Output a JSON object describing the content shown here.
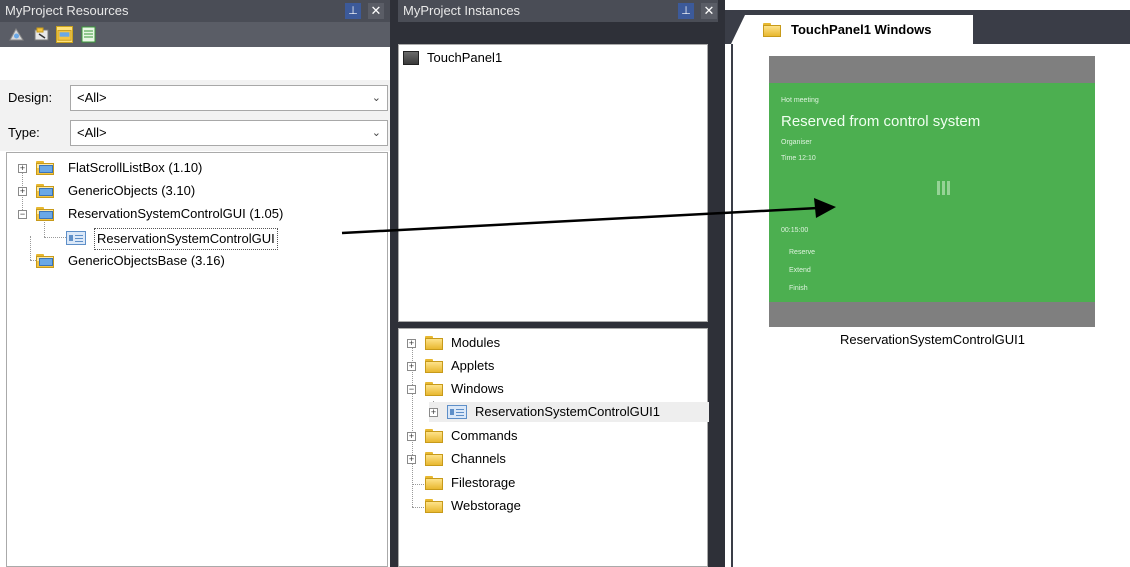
{
  "resources": {
    "title": "MyProject Resources",
    "design_label": "Design:",
    "design_value": "<All>",
    "type_label": "Type:",
    "type_value": "<All>",
    "tree": [
      {
        "label": "FlatScrollListBox (1.10)"
      },
      {
        "label": "GenericObjects (3.10)"
      },
      {
        "label": "ReservationSystemControlGUI (1.05)"
      },
      {
        "label": "ReservationSystemControlGUI"
      },
      {
        "label": "GenericObjectsBase (3.16)"
      }
    ]
  },
  "instances": {
    "title": "MyProject Instances",
    "top_item": "TouchPanel1",
    "tree": [
      {
        "label": "Modules"
      },
      {
        "label": "Applets"
      },
      {
        "label": "Windows"
      },
      {
        "label": "ReservationSystemControlGUI1"
      },
      {
        "label": "Commands"
      },
      {
        "label": "Channels"
      },
      {
        "label": "Filestorage"
      },
      {
        "label": "Webstorage"
      }
    ]
  },
  "windows": {
    "tab_label": "TouchPanel1 Windows",
    "thumbnail": {
      "line1": "Hot meeting",
      "headline": "Reserved from control system",
      "line2": "Organiser",
      "line3": "Time 12:10",
      "line4": "00:15:00",
      "line5": "Reserve",
      "line6": "Extend",
      "line7": "Finish"
    },
    "caption": "ReservationSystemControlGUI1"
  },
  "colors": {
    "header_bg": "#4a4d56",
    "pin_button": "#3c5a9a",
    "thumbnail_green": "#4caf50",
    "thumbnail_frame": "#7f7f7f"
  }
}
